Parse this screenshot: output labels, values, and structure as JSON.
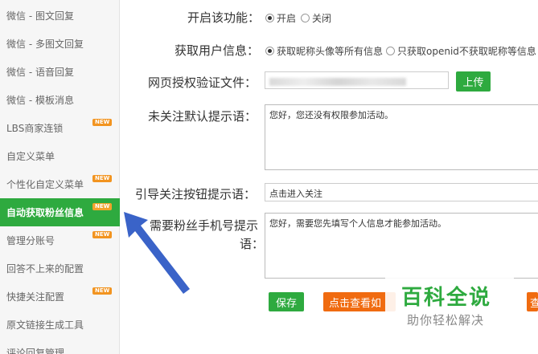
{
  "sidebar": {
    "items": [
      {
        "label": "微信 - 图文回复",
        "badge": ""
      },
      {
        "label": "微信 - 多图文回复",
        "badge": ""
      },
      {
        "label": "微信 - 语音回复",
        "badge": ""
      },
      {
        "label": "微信 - 模板消息",
        "badge": ""
      },
      {
        "label": "LBS商家连锁",
        "badge": "NEW"
      },
      {
        "label": "自定义菜单",
        "badge": ""
      },
      {
        "label": "个性化自定义菜单",
        "badge": "NEW"
      },
      {
        "label": "自动获取粉丝信息",
        "badge": "NEW"
      },
      {
        "label": "管理分账号",
        "badge": "NEW"
      },
      {
        "label": "回答不上来的配置",
        "badge": ""
      },
      {
        "label": "快捷关注配置",
        "badge": "NEW"
      },
      {
        "label": "原文链接生成工具",
        "badge": ""
      },
      {
        "label": "评论回复管理",
        "badge": ""
      }
    ],
    "active_index": 7
  },
  "form": {
    "enable": {
      "label": "开启该功能：",
      "opt_on": "开启",
      "opt_off": "关闭"
    },
    "userinfo": {
      "label": "获取用户信息：",
      "opt_all": "获取昵称头像等所有信息",
      "opt_openid": "只获取openid不获取昵称等信息"
    },
    "authfile": {
      "label": "网页授权验证文件：",
      "upload": "上传"
    },
    "unfollow_tip": {
      "label": "未关注默认提示语：",
      "value": "您好，您还没有权限参加活动。"
    },
    "guide_btn_tip": {
      "label": "引导关注按钮提示语：",
      "value": "点击进入关注"
    },
    "phone_tip": {
      "label_line1": "需要粉丝手机号提示",
      "label_line2": "语：",
      "value": "您好，需要您先填写个人信息才能参加活动。"
    },
    "buttons": {
      "save": "保存",
      "view": "点击查看如",
      "view2": "查"
    }
  },
  "watermark": {
    "title": "百科全说",
    "subtitle": "助你轻松解决"
  },
  "colors": {
    "accent": "#2eaa3f",
    "orange": "#f06b10",
    "arrow": "#3a63c8"
  }
}
